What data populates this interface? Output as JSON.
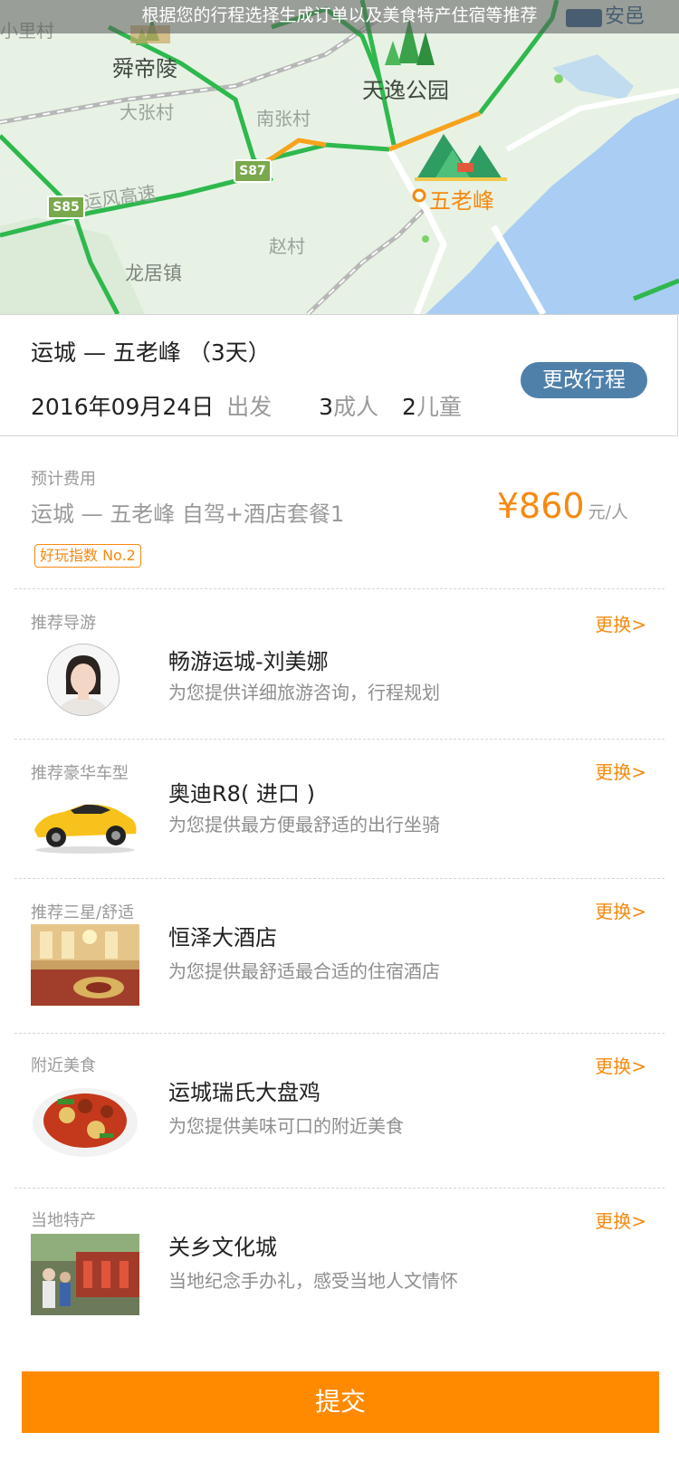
{
  "map": {
    "banner": "根据您的行程选择生成订单以及美食特产住宿等推荐",
    "labels": {
      "xiaolicun": "小里村",
      "shundiling": "舜帝陵",
      "tianyi_park": "天逸公园",
      "dazhangcun": "大张村",
      "nanzhangcun": "南张村",
      "yunfeng_highway": "运风高速",
      "wulaofeng": "五老峰",
      "zhaocun": "赵村",
      "longjuzhen": "龙居镇",
      "anyi": "安邑"
    },
    "shields": {
      "s85": "S85",
      "s87": "S87"
    }
  },
  "trip": {
    "title": "运城 — 五老峰 （3天）",
    "date": "2016年09月24日",
    "depart": "出发",
    "adults_num": "3",
    "adults_label": "成人",
    "children_num": "2",
    "children_label": "儿童",
    "change_button": "更改行程"
  },
  "cost": {
    "label": "预计费用",
    "route": "运城 — 五老峰  自驾+酒店套餐1",
    "price": "¥860",
    "unit": "元/人",
    "badge": "好玩指数 No.2"
  },
  "guide": {
    "label": "推荐导游",
    "swap": "更换>",
    "title": "畅游运城-刘美娜",
    "subtitle": "为您提供详细旅游咨询，行程规划"
  },
  "car": {
    "label": "推荐豪华车型",
    "swap": "更换>",
    "title": "奥迪R8( 进口 )",
    "subtitle": "为您提供最方便最舒适的出行坐骑"
  },
  "hotel": {
    "label": "推荐三星/舒适",
    "swap": "更换>",
    "title": "恒泽大酒店",
    "subtitle": "为您提供最舒适最合适的住宿酒店"
  },
  "food": {
    "label": "附近美食",
    "swap": "更换>",
    "title": "运城瑞氏大盘鸡",
    "subtitle": "为您提供美味可口的附近美食"
  },
  "specialty": {
    "label": "当地特产",
    "swap": "更换>",
    "title": "关乡文化城",
    "subtitle": "当地纪念手办礼，感受当地人文情怀"
  },
  "submit": "提交",
  "colors": {
    "accent": "#ff8a00",
    "button_blue": "#4f80aa",
    "map_bg": "#e7f2e5",
    "water": "#a9cdf3"
  }
}
